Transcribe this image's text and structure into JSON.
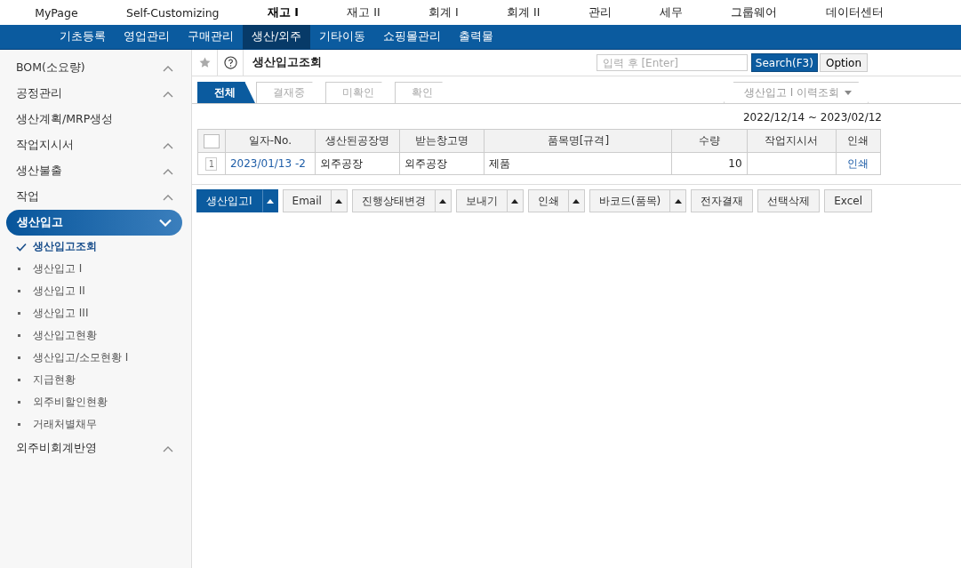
{
  "top_menu": [
    {
      "label": "MyPage",
      "selected": false
    },
    {
      "label": "Self-Customizing",
      "selected": false
    },
    {
      "label": "재고 I",
      "selected": true
    },
    {
      "label": "재고 II",
      "selected": false
    },
    {
      "label": "회계 I",
      "selected": false
    },
    {
      "label": "회계 II",
      "selected": false
    },
    {
      "label": "관리",
      "selected": false
    },
    {
      "label": "세무",
      "selected": false
    },
    {
      "label": "그룹웨어",
      "selected": false
    },
    {
      "label": "데이터센터",
      "selected": false
    }
  ],
  "sub_menu": [
    {
      "label": "기초등록",
      "selected": false
    },
    {
      "label": "영업관리",
      "selected": false
    },
    {
      "label": "구매관리",
      "selected": false
    },
    {
      "label": "생산/외주",
      "selected": true
    },
    {
      "label": "기타이동",
      "selected": false
    },
    {
      "label": "쇼핑몰관리",
      "selected": false
    },
    {
      "label": "출력물",
      "selected": false
    }
  ],
  "sidebar": {
    "items": [
      {
        "label": "BOM(소요량)",
        "kind": "group",
        "expanded": false,
        "selected": false
      },
      {
        "label": "공정관리",
        "kind": "group",
        "expanded": false,
        "selected": false
      },
      {
        "label": "생산계획/MRP생성",
        "kind": "link",
        "selected": false
      },
      {
        "label": "작업지시서",
        "kind": "group",
        "expanded": false,
        "selected": false
      },
      {
        "label": "생산불출",
        "kind": "group",
        "expanded": false,
        "selected": false
      },
      {
        "label": "작업",
        "kind": "group",
        "expanded": false,
        "selected": false
      },
      {
        "label": "생산입고",
        "kind": "group",
        "expanded": true,
        "selected": true,
        "children": [
          {
            "label": "생산입고조회",
            "selected": true
          },
          {
            "label": "생산입고 I",
            "selected": false
          },
          {
            "label": "생산입고 II",
            "selected": false
          },
          {
            "label": "생산입고 III",
            "selected": false
          },
          {
            "label": "생산입고현황",
            "selected": false
          },
          {
            "label": "생산입고/소모현황 I",
            "selected": false
          },
          {
            "label": "지급현황",
            "selected": false
          },
          {
            "label": "외주비할인현황",
            "selected": false
          },
          {
            "label": "거래처별채무",
            "selected": false
          }
        ]
      },
      {
        "label": "외주비회계반영",
        "kind": "group",
        "expanded": false,
        "selected": false
      }
    ]
  },
  "toolbar": {
    "title": "생산입고조회",
    "search": {
      "placeholder": "입력 후 [Enter]"
    },
    "buttons": [
      "Search(F3)",
      "Option"
    ]
  },
  "tabs": [
    {
      "label": "전체",
      "selected": true
    },
    {
      "label": "결재중",
      "selected": false
    },
    {
      "label": "미확인",
      "selected": false
    },
    {
      "label": "확인",
      "selected": false
    }
  ],
  "history_dropdown": "생산입고 I 이력조회",
  "date_range": "2022/12/14 ~ 2023/02/12",
  "table": {
    "columns": [
      "일자-No.",
      "생산된공장명",
      "받는창고명",
      "품목명[규격]",
      "수량",
      "작업지시서",
      "인쇄"
    ],
    "select_all": {
      "checked": false
    },
    "rows": [
      {
        "number": "1",
        "cells": [
          "2023/01/13 -2",
          "외주공장",
          "외주공장",
          "제품",
          "10",
          "",
          "인쇄"
        ]
      }
    ]
  },
  "action_buttons": [
    {
      "label": "생산입고I",
      "kind": "primary",
      "has_menu": true
    },
    {
      "label": "Email",
      "kind": "plain",
      "has_menu": true
    },
    {
      "label": "진행상태변경",
      "kind": "plain",
      "has_menu": true
    },
    {
      "label": "보내기",
      "kind": "plain",
      "has_menu": true
    },
    {
      "label": "인쇄",
      "kind": "plain",
      "has_menu": true
    },
    {
      "label": "바코드(품목)",
      "kind": "plain",
      "has_menu": true
    },
    {
      "label": "전자결재",
      "kind": "plain",
      "has_menu": false
    },
    {
      "label": "선택삭제",
      "kind": "plain",
      "has_menu": false
    },
    {
      "label": "Excel",
      "kind": "plain",
      "has_menu": false
    }
  ]
}
